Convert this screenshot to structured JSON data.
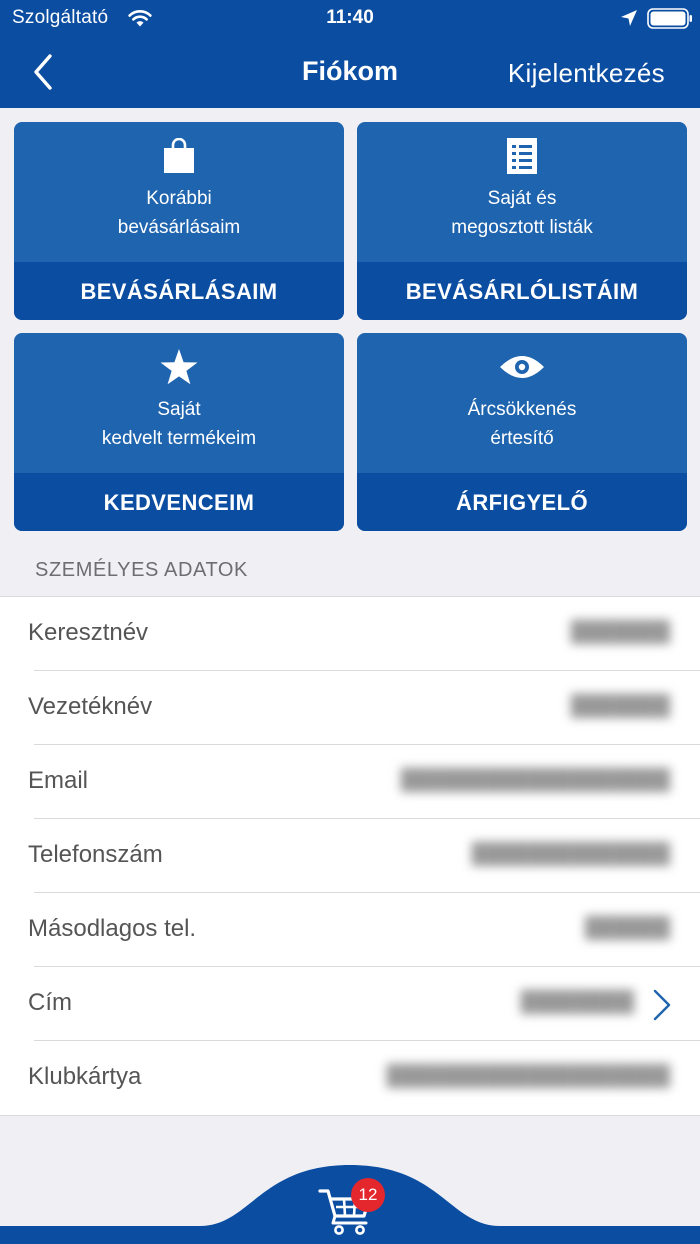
{
  "status_bar": {
    "carrier": "Szolgáltató",
    "time": "11:40"
  },
  "nav": {
    "title": "Fiókom",
    "logout_label": "Kijelentkezés"
  },
  "tiles": [
    {
      "icon": "shopping-bag-icon",
      "desc_line1": "Korábbi",
      "desc_line2": "bevásárlásaim",
      "label": "BEVÁSÁRLÁSAIM"
    },
    {
      "icon": "list-icon",
      "desc_line1": "Saját és",
      "desc_line2": "megosztott listák",
      "label": "BEVÁSÁRLÓLISTÁIM"
    },
    {
      "icon": "star-icon",
      "desc_line1": "Saját",
      "desc_line2": "kedvelt termékeim",
      "label": "KEDVENCEIM"
    },
    {
      "icon": "eye-icon",
      "desc_line1": "Árcsökkenés",
      "desc_line2": "értesítő",
      "label": "ÁRFIGYELŐ"
    }
  ],
  "personal": {
    "header": "SZEMÉLYES ADATOK",
    "rows": [
      {
        "label": "Keresztnév"
      },
      {
        "label": "Vezetéknév"
      },
      {
        "label": "Email"
      },
      {
        "label": "Telefonszám"
      },
      {
        "label": "Másodlagos tel."
      },
      {
        "label": "Cím"
      },
      {
        "label": "Klubkártya"
      }
    ]
  },
  "cart": {
    "badge_count": "12"
  },
  "colors": {
    "primary_dark": "#0b4da1",
    "tile_blue": "#1e64ae",
    "badge_red": "#e4262d",
    "background": "#efeff4"
  }
}
